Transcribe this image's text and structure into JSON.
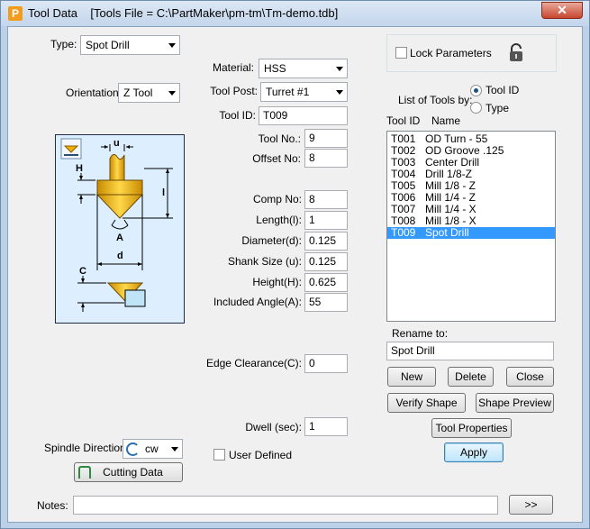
{
  "window": {
    "title": "Tool Data",
    "file_info": "[Tools File = C:\\PartMaker\\pm-tm\\Tm-demo.tdb]",
    "close_glyph": "✕"
  },
  "left": {
    "type_label": "Type:",
    "type_value": "Spot Drill",
    "orientation_label": "Orientation:",
    "orientation_value": "Z Tool",
    "spindle_label": "Spindle Direction:",
    "spindle_value": "cw",
    "cutting_data_label": "Cutting Data"
  },
  "diagram": {
    "labels": {
      "u": "u",
      "H": "H",
      "l": "l",
      "A": "A",
      "d": "d",
      "C": "C"
    }
  },
  "middle": {
    "material_label": "Material:",
    "material_value": "HSS",
    "toolpost_label": "Tool Post:",
    "toolpost_value": "Turret #1",
    "toolid_label": "Tool ID:",
    "toolid_value": "T009",
    "toolno_label": "Tool No.:",
    "toolno_value": "9",
    "offsetno_label": "Offset No:",
    "offsetno_value": "8",
    "compno_label": "Comp No:",
    "compno_value": "8",
    "length_label": "Length(l):",
    "length_value": "1",
    "diameter_label": "Diameter(d):",
    "diameter_value": "0.125",
    "shank_label": "Shank Size (u):",
    "shank_value": "0.125",
    "height_label": "Height(H):",
    "height_value": "0.625",
    "angle_label": "Included Angle(A):",
    "angle_value": "55",
    "edge_label": "Edge Clearance(C):",
    "edge_value": "0",
    "dwell_label": "Dwell (sec):",
    "dwell_value": "1",
    "user_defined_label": "User Defined"
  },
  "right": {
    "lock_label": "Lock Parameters",
    "list_by_label": "List of Tools by:",
    "radio_toolid": "Tool ID",
    "radio_type": "Type",
    "col_toolid": "Tool ID",
    "col_name": "Name",
    "tools": [
      {
        "id": "T001",
        "name": "OD Turn - 55"
      },
      {
        "id": "T002",
        "name": "OD Groove .125"
      },
      {
        "id": "T003",
        "name": "Center Drill"
      },
      {
        "id": "T004",
        "name": "Drill 1/8-Z"
      },
      {
        "id": "T005",
        "name": "Mill 1/8 - Z"
      },
      {
        "id": "T006",
        "name": "Mill 1/4 - Z"
      },
      {
        "id": "T007",
        "name": "Mill 1/4 - X"
      },
      {
        "id": "T008",
        "name": "Mill 1/8 - X"
      },
      {
        "id": "T009",
        "name": "Spot Drill"
      }
    ],
    "selected_index": 8,
    "rename_label": "Rename to:",
    "rename_value": "Spot Drill",
    "new_button": "New",
    "delete_button": "Delete",
    "close_button": "Close",
    "verify_button": "Verify Shape",
    "preview_button": "Shape Preview",
    "properties_button": "Tool Properties",
    "apply_button": "Apply"
  },
  "bottom": {
    "notes_label": "Notes:",
    "notes_value": "",
    "more_button": ">>"
  }
}
